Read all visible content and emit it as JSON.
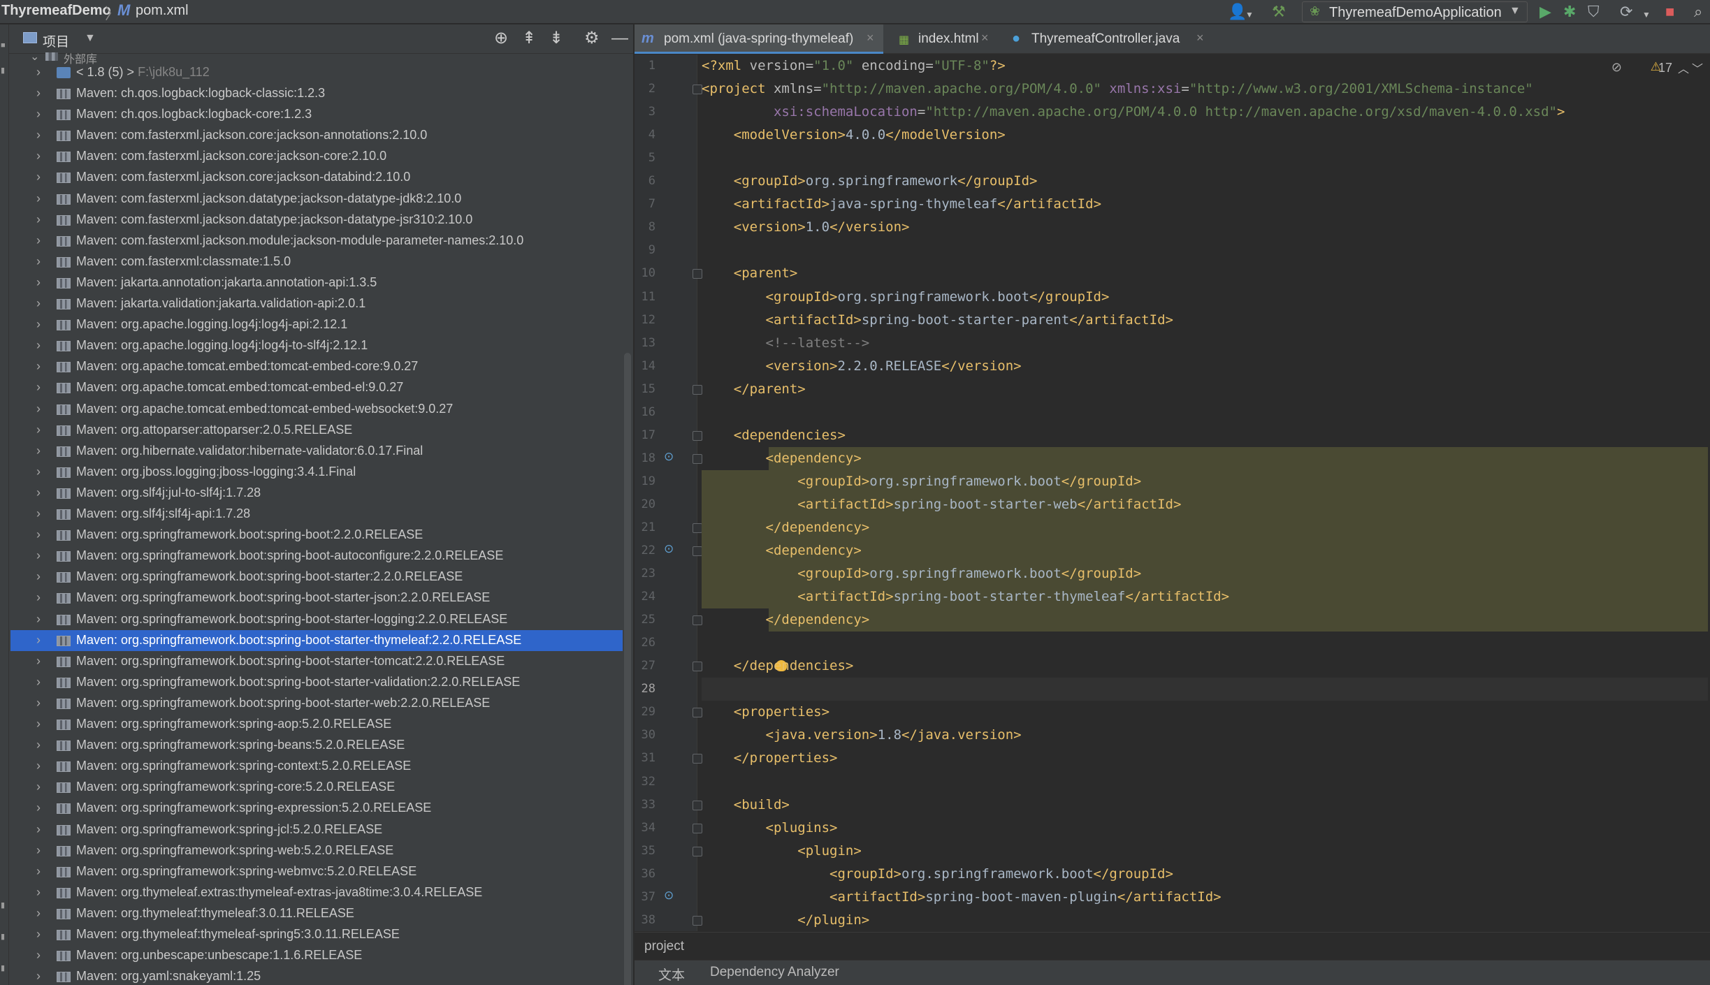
{
  "navbar": {
    "project": "ThyremeafDemo",
    "file_icon": "M",
    "file": "pom.xml"
  },
  "toolbar": {
    "run_config": "ThyremeafDemoApplication",
    "icons": [
      "user-icon",
      "hammer-icon",
      "run-icon",
      "debug-icon",
      "coverage-icon",
      "profiler-icon",
      "stop-icon",
      "search-icon"
    ]
  },
  "project_panel": {
    "title": "项目",
    "root_label": "外部库",
    "jdk": {
      "label": "< 1.8 (5) >",
      "path": "F:\\jdk8u_112"
    },
    "libraries": [
      "Maven: ch.qos.logback:logback-classic:1.2.3",
      "Maven: ch.qos.logback:logback-core:1.2.3",
      "Maven: com.fasterxml.jackson.core:jackson-annotations:2.10.0",
      "Maven: com.fasterxml.jackson.core:jackson-core:2.10.0",
      "Maven: com.fasterxml.jackson.core:jackson-databind:2.10.0",
      "Maven: com.fasterxml.jackson.datatype:jackson-datatype-jdk8:2.10.0",
      "Maven: com.fasterxml.jackson.datatype:jackson-datatype-jsr310:2.10.0",
      "Maven: com.fasterxml.jackson.module:jackson-module-parameter-names:2.10.0",
      "Maven: com.fasterxml:classmate:1.5.0",
      "Maven: jakarta.annotation:jakarta.annotation-api:1.3.5",
      "Maven: jakarta.validation:jakarta.validation-api:2.0.1",
      "Maven: org.apache.logging.log4j:log4j-api:2.12.1",
      "Maven: org.apache.logging.log4j:log4j-to-slf4j:2.12.1",
      "Maven: org.apache.tomcat.embed:tomcat-embed-core:9.0.27",
      "Maven: org.apache.tomcat.embed:tomcat-embed-el:9.0.27",
      "Maven: org.apache.tomcat.embed:tomcat-embed-websocket:9.0.27",
      "Maven: org.attoparser:attoparser:2.0.5.RELEASE",
      "Maven: org.hibernate.validator:hibernate-validator:6.0.17.Final",
      "Maven: org.jboss.logging:jboss-logging:3.4.1.Final",
      "Maven: org.slf4j:jul-to-slf4j:1.7.28",
      "Maven: org.slf4j:slf4j-api:1.7.28",
      "Maven: org.springframework.boot:spring-boot:2.2.0.RELEASE",
      "Maven: org.springframework.boot:spring-boot-autoconfigure:2.2.0.RELEASE",
      "Maven: org.springframework.boot:spring-boot-starter:2.2.0.RELEASE",
      "Maven: org.springframework.boot:spring-boot-starter-json:2.2.0.RELEASE",
      "Maven: org.springframework.boot:spring-boot-starter-logging:2.2.0.RELEASE",
      "Maven: org.springframework.boot:spring-boot-starter-thymeleaf:2.2.0.RELEASE",
      "Maven: org.springframework.boot:spring-boot-starter-tomcat:2.2.0.RELEASE",
      "Maven: org.springframework.boot:spring-boot-starter-validation:2.2.0.RELEASE",
      "Maven: org.springframework.boot:spring-boot-starter-web:2.2.0.RELEASE",
      "Maven: org.springframework:spring-aop:5.2.0.RELEASE",
      "Maven: org.springframework:spring-beans:5.2.0.RELEASE",
      "Maven: org.springframework:spring-context:5.2.0.RELEASE",
      "Maven: org.springframework:spring-core:5.2.0.RELEASE",
      "Maven: org.springframework:spring-expression:5.2.0.RELEASE",
      "Maven: org.springframework:spring-jcl:5.2.0.RELEASE",
      "Maven: org.springframework:spring-web:5.2.0.RELEASE",
      "Maven: org.springframework:spring-webmvc:5.2.0.RELEASE",
      "Maven: org.thymeleaf.extras:thymeleaf-extras-java8time:3.0.4.RELEASE",
      "Maven: org.thymeleaf:thymeleaf:3.0.11.RELEASE",
      "Maven: org.thymeleaf:thymeleaf-spring5:3.0.11.RELEASE",
      "Maven: org.unbescape:unbescape:1.1.6.RELEASE",
      "Maven: org.yaml:snakeyaml:1.25"
    ],
    "selected_library": "Maven: org.springframework.boot:spring-boot-starter-thymeleaf:2.2.0.RELEASE"
  },
  "editor_tabs": [
    {
      "icon": "m",
      "label": "pom.xml (java-spring-thymeleaf)",
      "active": true
    },
    {
      "icon": "html",
      "label": "index.html",
      "active": false
    },
    {
      "icon": "c",
      "label": "ThyremeafController.java",
      "active": false
    }
  ],
  "editor": {
    "warning_count": "17",
    "current_line": 28,
    "lines": [
      {
        "n": 1,
        "text": "<?xml version=\"1.0\" encoding=\"UTF-8\"?>"
      },
      {
        "n": 2,
        "text": "<project xmlns=\"http://maven.apache.org/POM/4.0.0\" xmlns:xsi=\"http://www.w3.org/2001/XMLSchema-instance\""
      },
      {
        "n": 3,
        "text": "         xsi:schemaLocation=\"http://maven.apache.org/POM/4.0.0 http://maven.apache.org/xsd/maven-4.0.0.xsd\">"
      },
      {
        "n": 4,
        "text": "    <modelVersion>4.0.0</modelVersion>"
      },
      {
        "n": 5,
        "text": ""
      },
      {
        "n": 6,
        "text": "    <groupId>org.springframework</groupId>"
      },
      {
        "n": 7,
        "text": "    <artifactId>java-spring-thymeleaf</artifactId>"
      },
      {
        "n": 8,
        "text": "    <version>1.0</version>"
      },
      {
        "n": 9,
        "text": ""
      },
      {
        "n": 10,
        "text": "    <parent>"
      },
      {
        "n": 11,
        "text": "        <groupId>org.springframework.boot</groupId>"
      },
      {
        "n": 12,
        "text": "        <artifactId>spring-boot-starter-parent</artifactId>"
      },
      {
        "n": 13,
        "text": "        <!--latest-->"
      },
      {
        "n": 14,
        "text": "        <version>2.2.0.RELEASE</version>"
      },
      {
        "n": 15,
        "text": "    </parent>"
      },
      {
        "n": 16,
        "text": ""
      },
      {
        "n": 17,
        "text": "    <dependencies>"
      },
      {
        "n": 18,
        "text": "        <dependency>"
      },
      {
        "n": 19,
        "text": "            <groupId>org.springframework.boot</groupId>"
      },
      {
        "n": 20,
        "text": "            <artifactId>spring-boot-starter-web</artifactId>"
      },
      {
        "n": 21,
        "text": "        </dependency>"
      },
      {
        "n": 22,
        "text": "        <dependency>"
      },
      {
        "n": 23,
        "text": "            <groupId>org.springframework.boot</groupId>"
      },
      {
        "n": 24,
        "text": "            <artifactId>spring-boot-starter-thymeleaf</artifactId>"
      },
      {
        "n": 25,
        "text": "        </dependency>"
      },
      {
        "n": 26,
        "text": ""
      },
      {
        "n": 27,
        "text": "    </dependencies>"
      },
      {
        "n": 28,
        "text": ""
      },
      {
        "n": 29,
        "text": "    <properties>"
      },
      {
        "n": 30,
        "text": "        <java.version>1.8</java.version>"
      },
      {
        "n": 31,
        "text": "    </properties>"
      },
      {
        "n": 32,
        "text": ""
      },
      {
        "n": 33,
        "text": "    <build>"
      },
      {
        "n": 34,
        "text": "        <plugins>"
      },
      {
        "n": 35,
        "text": "            <plugin>"
      },
      {
        "n": 36,
        "text": "                <groupId>org.springframework.boot</groupId>"
      },
      {
        "n": 37,
        "text": "                <artifactId>spring-boot-maven-plugin</artifactId>"
      },
      {
        "n": 38,
        "text": "            </plugin>"
      }
    ]
  },
  "breadcrumb": "project",
  "bottom_tabs": [
    "文本",
    "Dependency Analyzer"
  ],
  "colors": {
    "background": "#2b2b2b",
    "panel": "#3c3f41",
    "selection": "#2f65ca",
    "xml_tag": "#e8bf6a",
    "xml_value": "#6a8759",
    "xml_text": "#a9b7c6",
    "highlight": "#4a4a33"
  }
}
